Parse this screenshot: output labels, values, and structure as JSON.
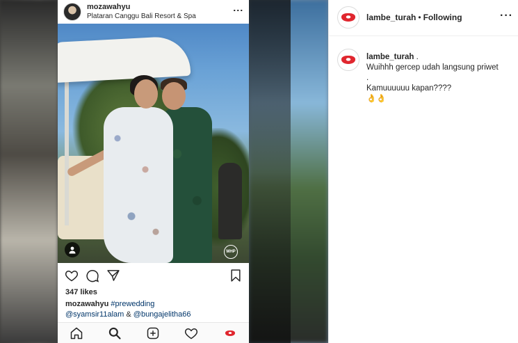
{
  "phone": {
    "username": "mozawahyu",
    "location": "Plataran Canggu Bali Resort & Spa",
    "watermark": "MHP",
    "likes": "347 likes",
    "caption_user": "mozawahyu",
    "caption_hashtag": "#prewedding",
    "mention_1": "@syamsir11alam",
    "mention_sep": " & ",
    "mention_2": "@bungajelitha66"
  },
  "post": {
    "header_username": "lambe_turah",
    "header_separator": "•",
    "header_follow_status": "Following",
    "comment_username": "lambe_turah",
    "comment_user_suffix": " .",
    "comment_lines": [
      "Wuihhh gercep udah langsung priwet",
      ".",
      "Kamuuuuuu kapan????",
      "👌👌"
    ]
  },
  "colors": {
    "text": "#262626",
    "link": "#003569",
    "border": "#efefef",
    "brand_lips": "#e0262e"
  }
}
